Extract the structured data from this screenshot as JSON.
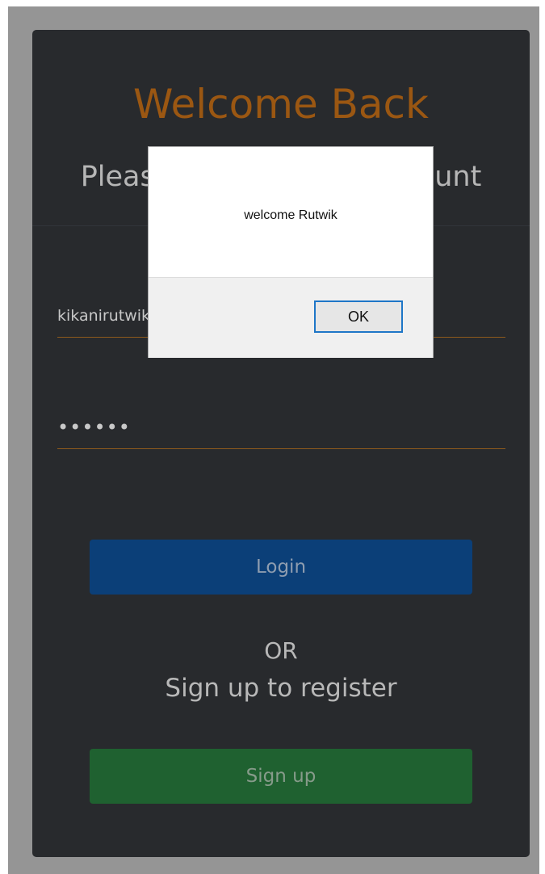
{
  "header": {
    "title": "Welcome Back",
    "subtitle": "Please login to your account"
  },
  "form": {
    "email": {
      "value": "kikanirutwik"
    },
    "password": {
      "value": "••••••"
    },
    "login_label": "Login",
    "or_label": "OR",
    "register_label": "Sign up to register",
    "signup_label": "Sign up"
  },
  "dialog": {
    "message": "welcome Rutwik",
    "ok_label": "OK"
  },
  "colors": {
    "title": "#9b5712",
    "card_bg": "#282a2d",
    "login_button": "#0b3f78",
    "signup_button": "#1f6130",
    "field_underline": "#8e5a1d"
  }
}
